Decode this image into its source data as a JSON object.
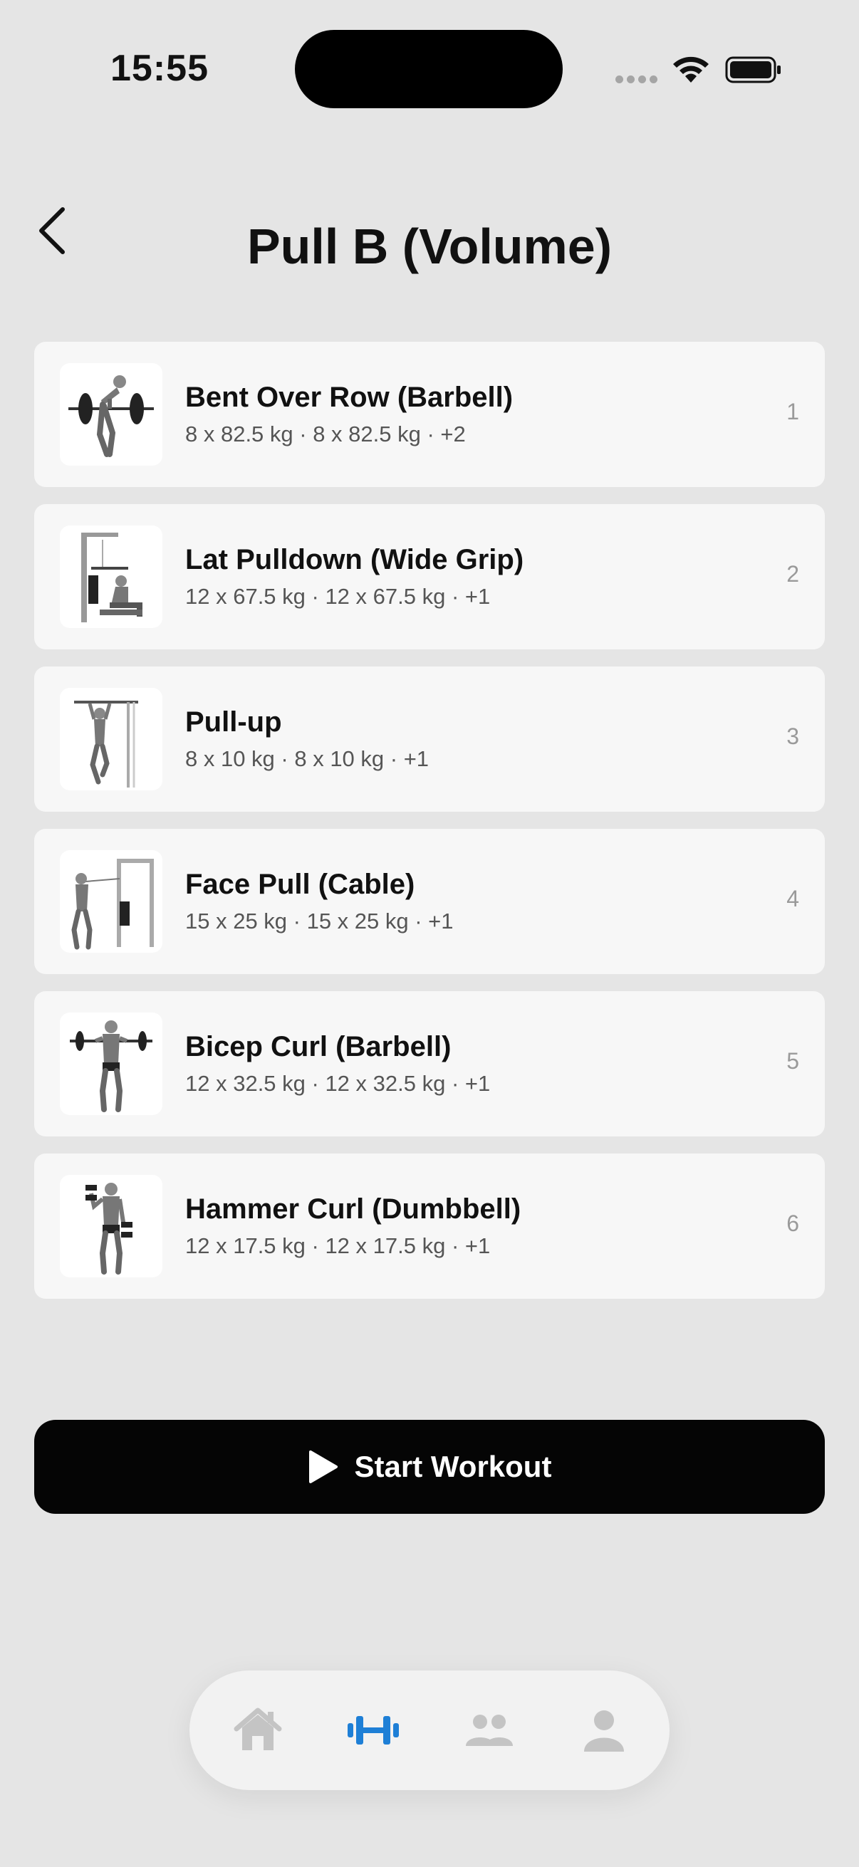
{
  "status_bar": {
    "time": "15:55"
  },
  "header": {
    "title": "Pull B (Volume)"
  },
  "exercises": [
    {
      "name": "Bent Over Row (Barbell)",
      "sets": "8 x 82.5 kg · 8 x 82.5 kg · +2",
      "order": "1",
      "image": "bent-over-row-illustration"
    },
    {
      "name": "Lat Pulldown (Wide Grip)",
      "sets": "12 x 67.5 kg · 12 x 67.5 kg · +1",
      "order": "2",
      "image": "lat-pulldown-illustration"
    },
    {
      "name": "Pull-up",
      "sets": "8 x 10 kg · 8 x 10 kg · +1",
      "order": "3",
      "image": "pull-up-illustration"
    },
    {
      "name": "Face Pull (Cable)",
      "sets": "15 x 25 kg · 15 x 25 kg · +1",
      "order": "4",
      "image": "face-pull-illustration"
    },
    {
      "name": "Bicep Curl (Barbell)",
      "sets": "12 x 32.5 kg · 12 x 32.5 kg · +1",
      "order": "5",
      "image": "bicep-curl-illustration"
    },
    {
      "name": "Hammer Curl (Dumbbell)",
      "sets": "12 x 17.5 kg · 12 x 17.5 kg · +1",
      "order": "6",
      "image": "hammer-curl-illustration"
    }
  ],
  "actions": {
    "start_label": "Start Workout"
  },
  "tab_bar": {
    "tabs": [
      {
        "icon": "home-icon",
        "active": false
      },
      {
        "icon": "dumbbell-icon",
        "active": true
      },
      {
        "icon": "people-icon",
        "active": false
      },
      {
        "icon": "person-icon",
        "active": false
      }
    ]
  },
  "colors": {
    "background": "#e5e5e5",
    "card": "#f7f7f7",
    "primary_button": "#050505",
    "active_tab": "#1e7fd6",
    "inactive_tab": "#bdbdbd"
  }
}
